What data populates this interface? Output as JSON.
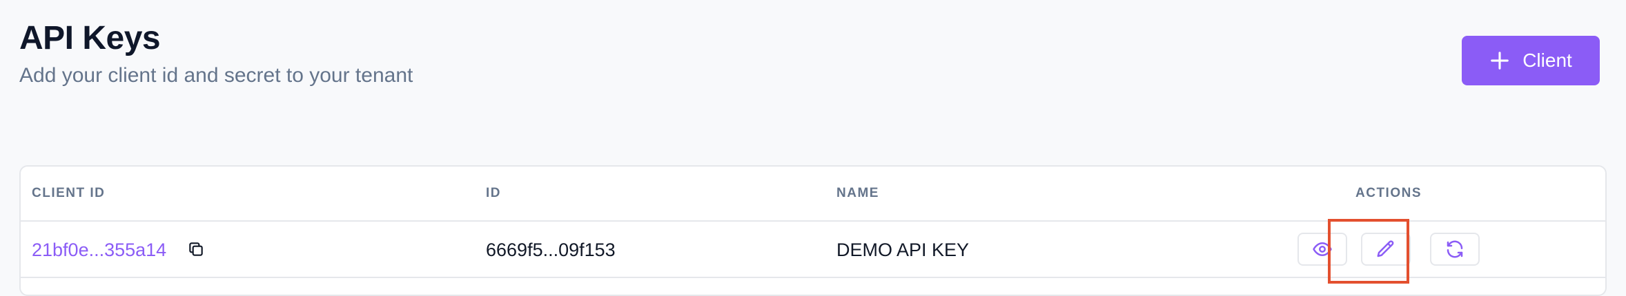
{
  "header": {
    "title": "API Keys",
    "subtitle": "Add your client id and secret to your tenant",
    "add_button_label": "Client"
  },
  "table": {
    "columns": [
      "CLIENT ID",
      "ID",
      "NAME",
      "ACTIONS"
    ],
    "rows": [
      {
        "client_id": "21bf0e...355a14",
        "id": "6669f5...09f153",
        "name": "DEMO API KEY"
      }
    ]
  },
  "icons": {
    "add": "plus-icon",
    "copy": "copy-icon",
    "view": "eye-icon",
    "edit": "pencil-icon",
    "regenerate": "refresh-icon"
  },
  "colors": {
    "accent": "#8b5cf6",
    "highlight": "#e3502f",
    "muted_text": "#64748b"
  }
}
